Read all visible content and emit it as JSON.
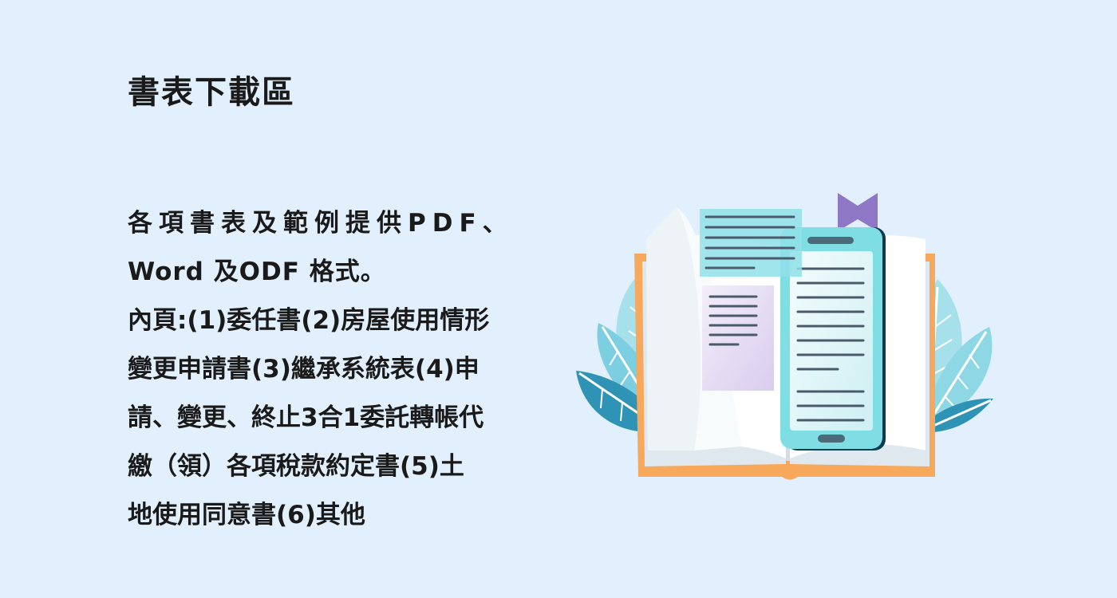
{
  "page": {
    "title": "書表下載區",
    "description_lines": [
      "各項書表及範例提供PDF、",
      "Word 及ODF 格式。",
      "內頁:(1)委任書(2)房屋使用情形",
      "變更申請書(3)繼承系統表(4)申",
      "請、變更、終止3合1委託轉帳代",
      "繳（領）各項稅款約定書(5)土",
      "地使用同意書(6)其他"
    ]
  },
  "illustration": {
    "icon": "open-book-with-phone-icon",
    "colors": {
      "background": "#e1f0fc",
      "book_cover": "#f7a85a",
      "page": "#ffffff",
      "leaf_light": "#a6e0ea",
      "leaf_dark": "#2f93b5",
      "phone_body": "#7fdde4",
      "phone_screen": "#e8f7f9",
      "bookmark": "#8e77c4",
      "doc_card": "#8fe0e8",
      "text_line": "#4a5a6b"
    }
  }
}
